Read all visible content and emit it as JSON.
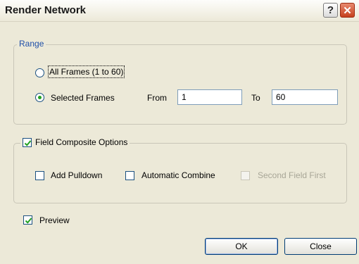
{
  "window": {
    "title": "Render Network",
    "help_label": "?",
    "close_label": "✕"
  },
  "range": {
    "legend": "Range",
    "all_frames_label": "All Frames (1 to 60)",
    "selected_frames_label": "Selected Frames",
    "selected_option": "Selected Frames",
    "from_label": "From",
    "from_value": "1",
    "to_label": "To",
    "to_value": "60"
  },
  "composite": {
    "legend": "Field Composite Options",
    "enabled": true,
    "add_pulldown_label": "Add Pulldown",
    "add_pulldown_checked": false,
    "automatic_combine_label": "Automatic Combine",
    "automatic_combine_checked": false,
    "second_field_first_label": "Second Field First",
    "second_field_first_checked": false,
    "second_field_first_enabled": false
  },
  "preview": {
    "label": "Preview",
    "checked": true
  },
  "buttons": {
    "ok_label": "OK",
    "close_label": "Close"
  },
  "colors": {
    "dialog_bg": "#ece9d8",
    "accent_check": "#21a121",
    "close_button": "#c6401e"
  }
}
